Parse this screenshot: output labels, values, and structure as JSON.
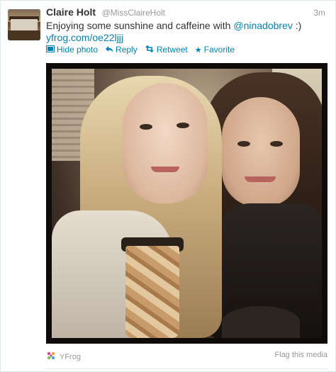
{
  "tweet": {
    "name": "Claire Holt",
    "handle": "@MissClaireHolt",
    "time": "3m",
    "text_before": "Enjoying some sunshine and caffeine with ",
    "mention": "@ninadobrev",
    "text_after": " :)",
    "link": "yfrog.com/oe22ljjj"
  },
  "actions": {
    "hide_photo": "Hide photo",
    "reply": "Reply",
    "retweet": "Retweet",
    "favorite": "Favorite"
  },
  "media": {
    "provider": "YFrog",
    "flag": "Flag this media"
  },
  "icons": {
    "hide_photo": "photo-icon",
    "reply": "reply-arrow-icon",
    "retweet": "retweet-icon",
    "favorite": "star-icon",
    "provider": "yfrog-logo-icon"
  },
  "colors": {
    "link": "#0084b4",
    "muted": "#999999",
    "text": "#333333"
  }
}
